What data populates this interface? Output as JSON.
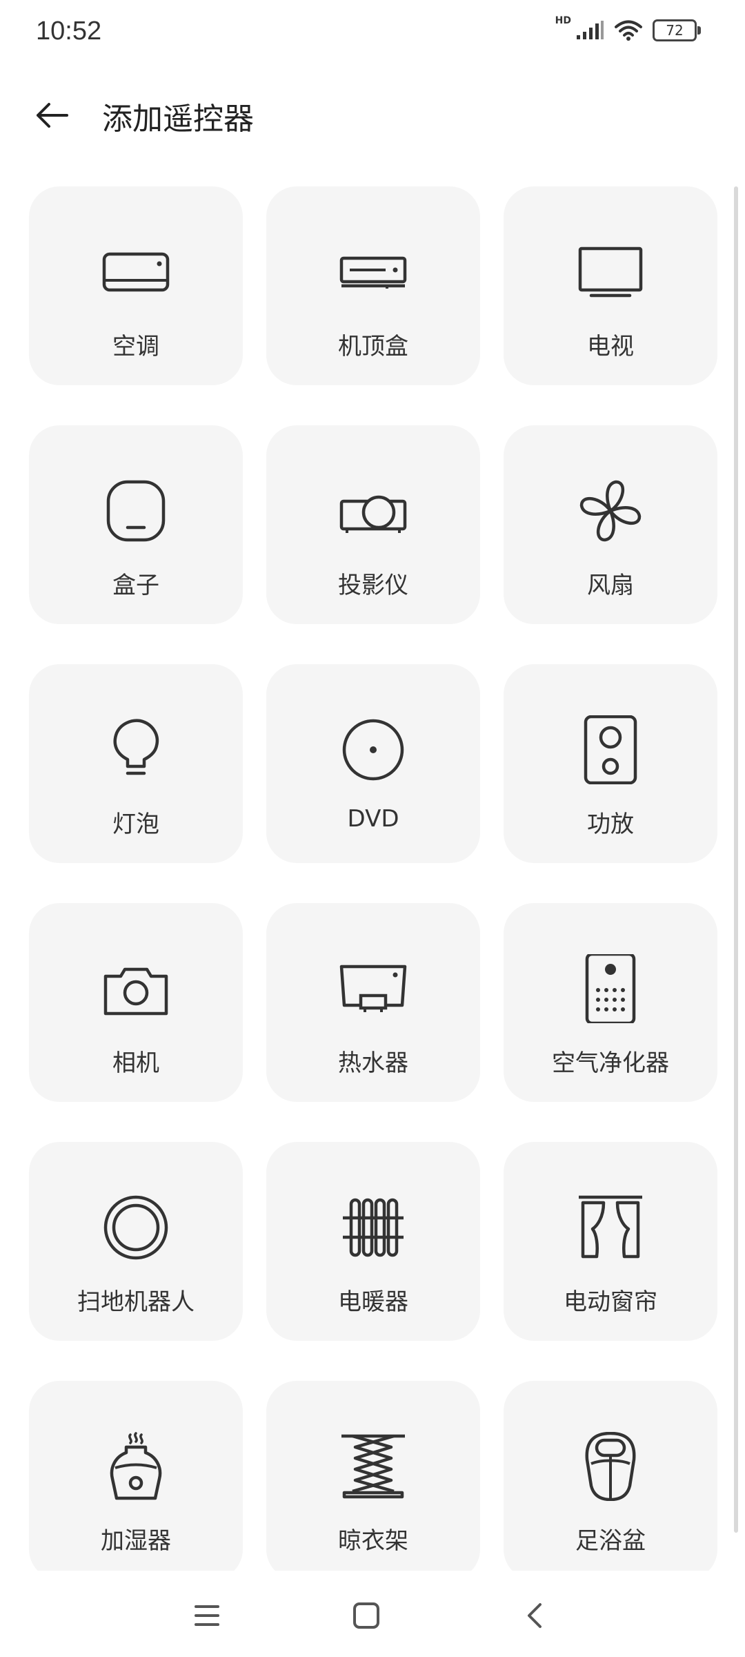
{
  "status_bar": {
    "time": "10:52",
    "network_label": "HD",
    "battery": "72"
  },
  "header": {
    "title": "添加遥控器"
  },
  "devices": [
    {
      "label": "空调"
    },
    {
      "label": "机顶盒"
    },
    {
      "label": "电视"
    },
    {
      "label": "盒子"
    },
    {
      "label": "投影仪"
    },
    {
      "label": "风扇"
    },
    {
      "label": "灯泡"
    },
    {
      "label": "DVD"
    },
    {
      "label": "功放"
    },
    {
      "label": "相机"
    },
    {
      "label": "热水器"
    },
    {
      "label": "空气净化器"
    },
    {
      "label": "扫地机器人"
    },
    {
      "label": "电暖器"
    },
    {
      "label": "电动窗帘"
    },
    {
      "label": "加湿器"
    },
    {
      "label": "晾衣架"
    },
    {
      "label": "足浴盆"
    }
  ]
}
